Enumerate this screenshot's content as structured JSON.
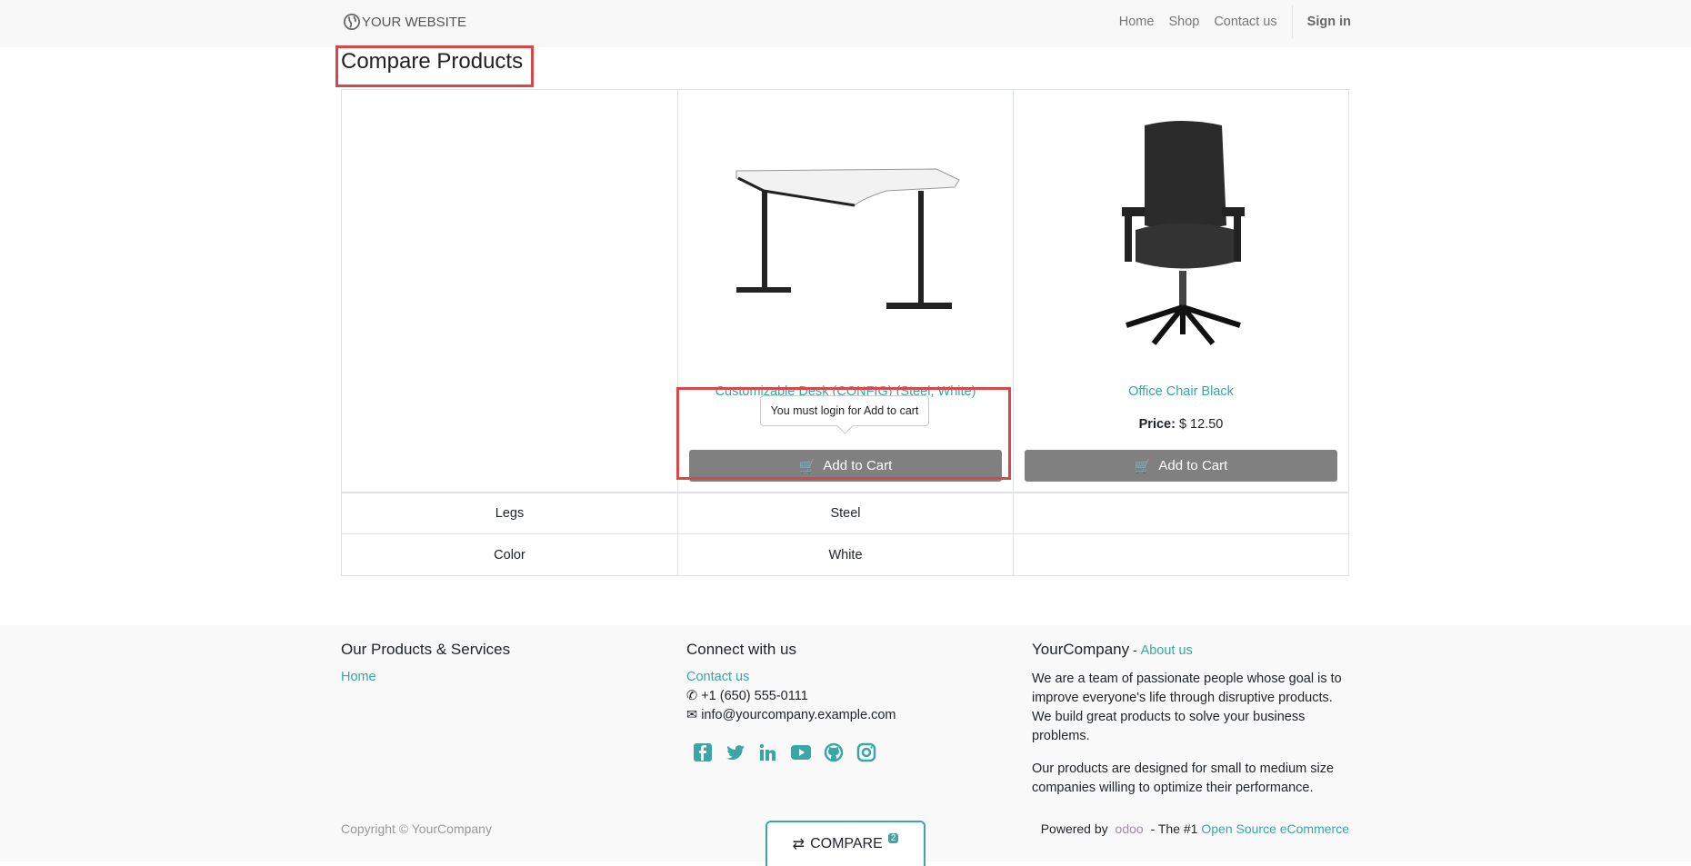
{
  "nav": {
    "brand": "YOUR WEBSITE",
    "items": [
      "Home",
      "Shop",
      "Contact us"
    ],
    "sign_in": "Sign in"
  },
  "page_title": "Compare Products",
  "products": [
    {
      "name": "Customizable Desk (CONFIG) (Steel, White)",
      "price_label": "",
      "price": "",
      "add_to_cart": "Add to Cart",
      "tooltip": "You must login for Add to cart"
    },
    {
      "name": "Office Chair Black",
      "price_label": "Price:",
      "price": "$ 12.50",
      "add_to_cart": "Add to Cart"
    }
  ],
  "attributes": [
    {
      "name": "Legs",
      "values": [
        "Steel",
        ""
      ]
    },
    {
      "name": "Color",
      "values": [
        "White",
        ""
      ]
    }
  ],
  "footer": {
    "col1": {
      "title": "Our Products & Services",
      "links": [
        "Home"
      ]
    },
    "col2": {
      "title": "Connect with us",
      "contact": "Contact us",
      "phone": "+1 (650) 555-0111",
      "email": "info@yourcompany.example.com",
      "social": [
        "facebook-icon",
        "twitter-icon",
        "linkedin-icon",
        "youtube-icon",
        "github-icon",
        "instagram-icon"
      ]
    },
    "col3": {
      "title": "YourCompany",
      "sep": " - ",
      "about": "About us",
      "p1": "We are a team of passionate people whose goal is to improve everyone's life through disruptive products. We build great products to solve your business problems.",
      "p2": "Our products are designed for small to medium size companies willing to optimize their performance."
    },
    "copyright": "Copyright © YourCompany",
    "powered_by": "Powered by",
    "odoo": "odoo",
    "tagline": " - The #1 ",
    "ecommerce": "Open Source eCommerce"
  },
  "compare": {
    "label": "COMPARE",
    "count": "2"
  },
  "colors": {
    "accent": "#3aa6a5",
    "button": "#808080",
    "highlight": "#d9474a"
  }
}
